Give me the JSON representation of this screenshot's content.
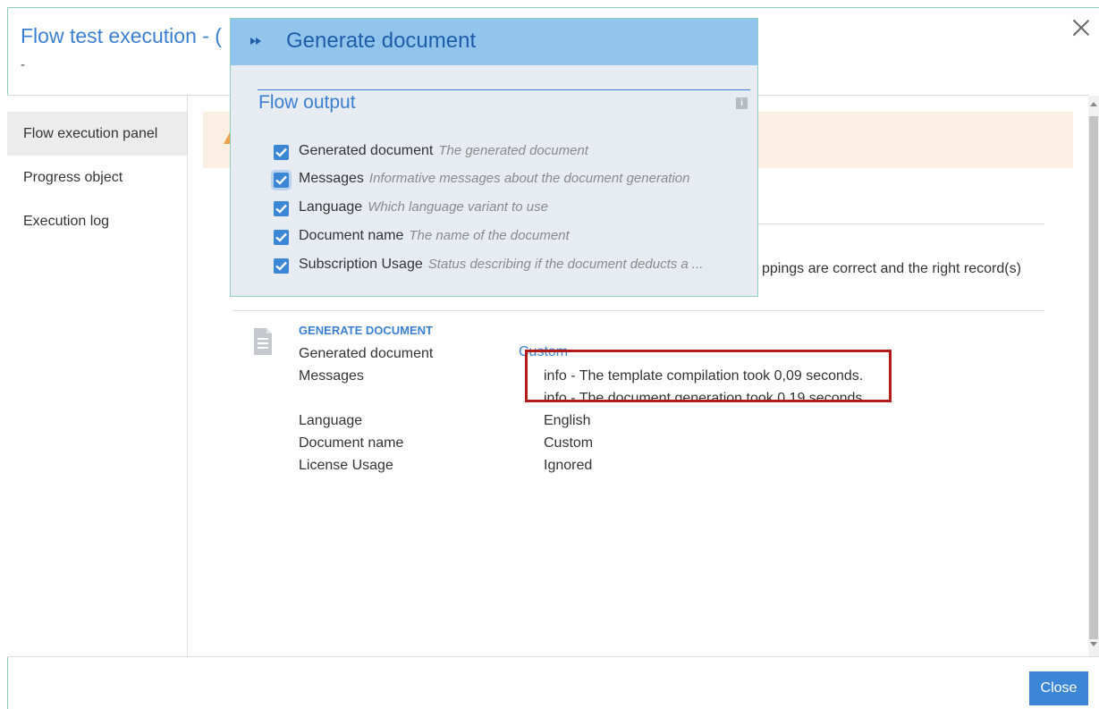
{
  "dialog": {
    "title": "Flow test execution - (",
    "subtitle": "-",
    "close_button_label": "Close"
  },
  "sidebar": {
    "items": [
      {
        "label": "Flow execution panel",
        "active": true
      },
      {
        "label": "Progress object",
        "active": false
      },
      {
        "label": "Execution log",
        "active": false
      }
    ]
  },
  "background": {
    "partial_text": "ppings are correct and the right record(s)"
  },
  "generate_document": {
    "heading": "GENERATE DOCUMENT",
    "rows": [
      {
        "label": "Generated document",
        "value": "Custom"
      },
      {
        "label": "Messages",
        "value": "info - The template compilation took 0,09 seconds."
      },
      {
        "label": "",
        "value": "info - The document generation took 0,19 seconds."
      },
      {
        "label": "Language",
        "value": "English"
      },
      {
        "label": "Document name",
        "value": "Custom"
      },
      {
        "label": "License Usage",
        "value": "Ignored"
      }
    ]
  },
  "popup": {
    "title": "Generate document",
    "section_title": "Flow output",
    "outputs": [
      {
        "label": "Generated document",
        "description": "The generated document",
        "checked": true
      },
      {
        "label": "Messages",
        "description": "Informative messages about the document generation",
        "checked": true
      },
      {
        "label": "Language",
        "description": "Which language variant to use",
        "checked": true
      },
      {
        "label": "Document name",
        "description": "The name of the document",
        "checked": true
      },
      {
        "label": "Subscription Usage",
        "description": "Status describing if the document deducts a ...",
        "checked": true
      }
    ]
  },
  "colors": {
    "accent": "#3b7fd0",
    "popup_header": "#92c5ee",
    "highlight": "#b31b1b",
    "warning_bg": "#fbeee2"
  }
}
